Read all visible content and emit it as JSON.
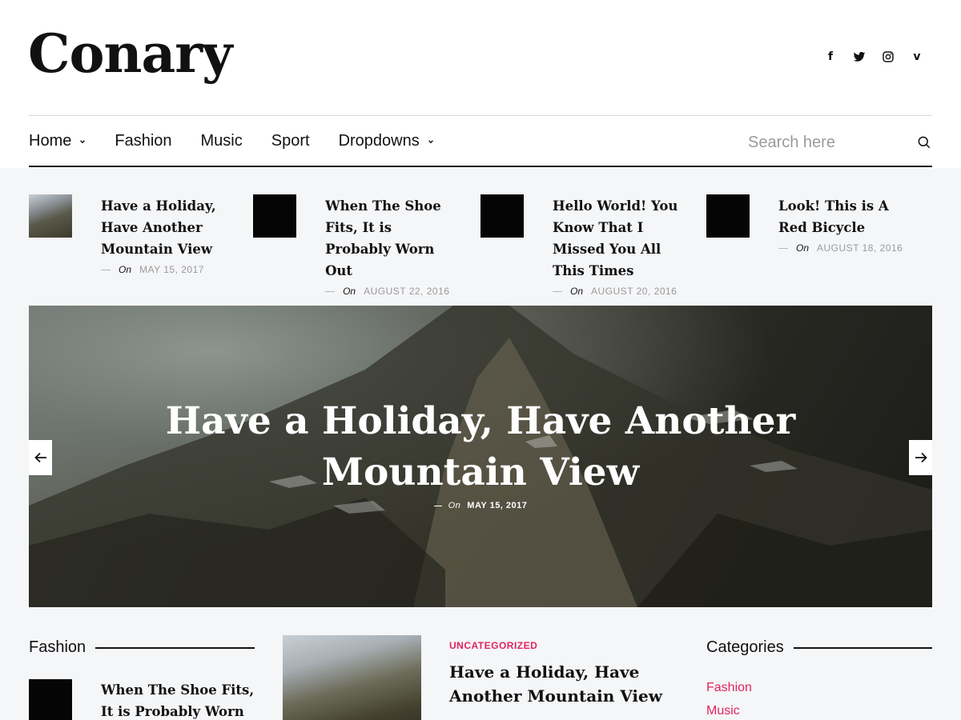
{
  "site": {
    "logo": "Conary"
  },
  "social": [
    {
      "icon": "facebook-icon",
      "glyph": "f"
    },
    {
      "icon": "twitter-icon"
    },
    {
      "icon": "instagram-icon"
    },
    {
      "icon": "vimeo-icon",
      "glyph": "v"
    }
  ],
  "nav": {
    "items": [
      {
        "label": "Home",
        "has_dropdown": true
      },
      {
        "label": "Fashion",
        "has_dropdown": false
      },
      {
        "label": "Music",
        "has_dropdown": false
      },
      {
        "label": "Sport",
        "has_dropdown": false
      },
      {
        "label": "Dropdowns",
        "has_dropdown": true
      }
    ],
    "search_placeholder": "Search here"
  },
  "mini_posts": [
    {
      "title": "Have a Holiday, Have Another Mountain View",
      "on": "On",
      "date": "MAY 15, 2017",
      "thumb": "mountain"
    },
    {
      "title": "When The Shoe Fits, It is Probably Worn Out",
      "on": "On",
      "date": "AUGUST 22, 2016",
      "thumb": "dark"
    },
    {
      "title": "Hello World! You Know That I Missed You All This Times",
      "on": "On",
      "date": "AUGUST 20, 2016",
      "thumb": "dark"
    },
    {
      "title": "Look! This is A Red Bicycle",
      "on": "On",
      "date": "AUGUST 18, 2016",
      "thumb": "dark"
    }
  ],
  "hero": {
    "title": "Have a Holiday, Have Another Mountain View",
    "on": "On",
    "date": "MAY 15, 2017"
  },
  "fashion_section": {
    "heading": "Fashion",
    "first_item_title": "When The Shoe Fits, It is Probably Worn Out"
  },
  "feature_post": {
    "category": "UNCATEGORIZED",
    "title": "Have a Holiday, Have Another Mountain View"
  },
  "categories_section": {
    "heading": "Categories",
    "items": [
      "Fashion",
      "Music"
    ]
  },
  "colors": {
    "accent": "#e0245e",
    "text": "#111111",
    "background": "#f5f6f8"
  }
}
